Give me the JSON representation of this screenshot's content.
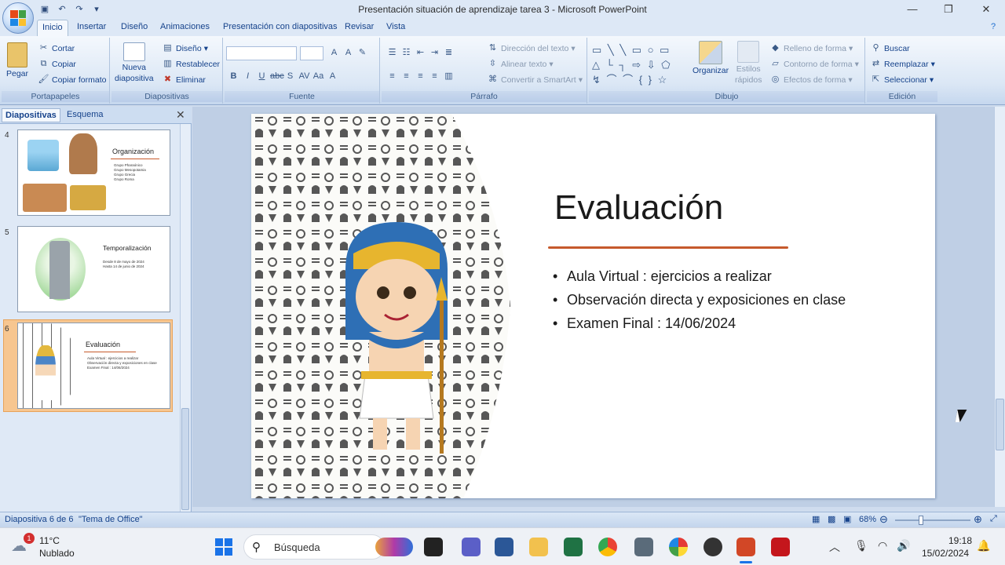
{
  "window": {
    "title": "Presentación situación de aprendizaje tarea 3 - Microsoft PowerPoint"
  },
  "ribbon_tabs": [
    "Inicio",
    "Insertar",
    "Diseño",
    "Animaciones",
    "Presentación con diapositivas",
    "Revisar",
    "Vista"
  ],
  "groups": {
    "portapapeles": {
      "label": "Portapapeles",
      "pegar": "Pegar",
      "cortar": "Cortar",
      "copiar": "Copiar",
      "copiar_formato": "Copiar formato"
    },
    "diapositivas": {
      "label": "Diapositivas",
      "nueva": "Nueva",
      "nueva2": "diapositiva",
      "diseno": "Diseño",
      "restablecer": "Restablecer",
      "eliminar": "Eliminar"
    },
    "fuente": {
      "label": "Fuente"
    },
    "parrafo": {
      "label": "Párrafo",
      "direccion": "Dirección del texto",
      "alinear": "Alinear texto",
      "smartart": "Convertir a SmartArt"
    },
    "dibujo": {
      "label": "Dibujo",
      "organizar": "Organizar",
      "estilos": "Estilos",
      "rapidos": "rápidos",
      "relleno": "Relleno de forma",
      "contorno": "Contorno de forma",
      "efectos": "Efectos de forma"
    },
    "edicion": {
      "label": "Edición",
      "buscar": "Buscar",
      "reemplazar": "Reemplazar",
      "seleccionar": "Seleccionar"
    }
  },
  "left_pane": {
    "tab_slides": "Diapositivas",
    "tab_outline": "Esquema",
    "thumbs": [
      {
        "num": "4",
        "title": "Organización",
        "lines": [
          "Grupo Pharaónico",
          "Grupo Mesopotamia",
          "Grupo Grecia",
          "Grupo Roma"
        ]
      },
      {
        "num": "5",
        "title": "Temporalización",
        "lines": [
          "Desde 8 de mayo de 2024",
          "Hasta 14 de junio de 2024"
        ]
      },
      {
        "num": "6",
        "title": "Evaluación",
        "lines": [
          "Aula Virtual : ejercicios a realizar",
          "Observación directa y exposiciones en clase",
          "Examen Final : 14/06/2024"
        ]
      }
    ]
  },
  "slide": {
    "title": "Evaluación",
    "bullets": [
      "Aula Virtual : ejercicios a realizar",
      "Observación directa y exposiciones en clase",
      "Examen Final : 14/06/2024"
    ]
  },
  "status": {
    "slide": "Diapositiva 6 de 6",
    "theme": "\"Tema de Office\"",
    "zoom": "68%"
  },
  "taskbar": {
    "temp": "11°C",
    "weather": "Nublado",
    "badge": "1",
    "search": "Búsqueda",
    "time": "19:18",
    "date": "15/02/2024"
  }
}
